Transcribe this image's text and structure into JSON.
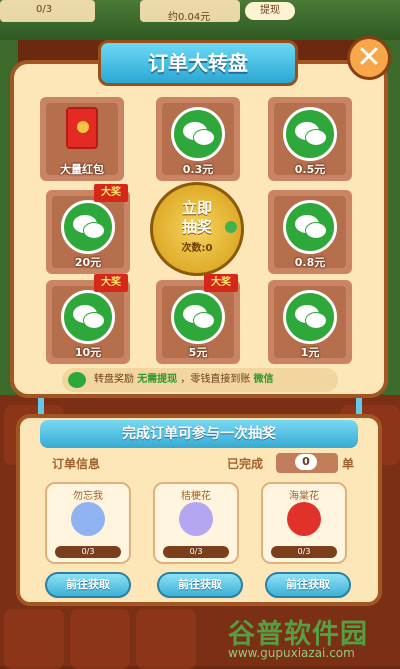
{
  "background": {
    "top_values": [
      "0/3",
      "0/3"
    ],
    "top_amount": "约0.04元",
    "top_button": "提现"
  },
  "wheel": {
    "title": "订单大转盘",
    "close_label": "✕",
    "prizes": [
      {
        "label": "大量红包",
        "kind": "red-envelope",
        "badge": ""
      },
      {
        "label": "0.3元",
        "kind": "wechat",
        "badge": ""
      },
      {
        "label": "0.5元",
        "kind": "wechat",
        "badge": ""
      },
      {
        "label": "20元",
        "kind": "wechat",
        "badge": "大奖"
      },
      {
        "label": "0.8元",
        "kind": "wechat",
        "badge": ""
      },
      {
        "label": "10元",
        "kind": "wechat",
        "badge": "大奖"
      },
      {
        "label": "5元",
        "kind": "wechat",
        "badge": "大奖"
      },
      {
        "label": "1元",
        "kind": "wechat",
        "badge": ""
      }
    ],
    "draw": {
      "line1": "立即",
      "line2": "抽奖",
      "count": "次数:0"
    },
    "note": {
      "pre": "转盘奖励",
      "free": "无需提现",
      "post": "，零钱直接到账",
      "wx": "微信"
    }
  },
  "orders": {
    "title": "完成订单可参与一次抽奖",
    "info_label": "订单信息",
    "done_label": "已完成",
    "done_value": "0",
    "done_unit": "单",
    "flowers": [
      {
        "name": "勿忘我",
        "progress": "0/3",
        "color": "#8fb3f0"
      },
      {
        "name": "桔梗花",
        "progress": "0/3",
        "color": "#b4a6f0"
      },
      {
        "name": "海棠花",
        "progress": "0/3",
        "color": "#e0322b"
      }
    ],
    "go_label": "前往获取"
  },
  "watermark": {
    "cn": "谷普软件园",
    "url": "www.gupuxiazai.com"
  },
  "colors": {
    "wechat": "#2ea83a",
    "badge": "#d62819",
    "accent": "#36abd3",
    "panel": "#fde6b8"
  }
}
